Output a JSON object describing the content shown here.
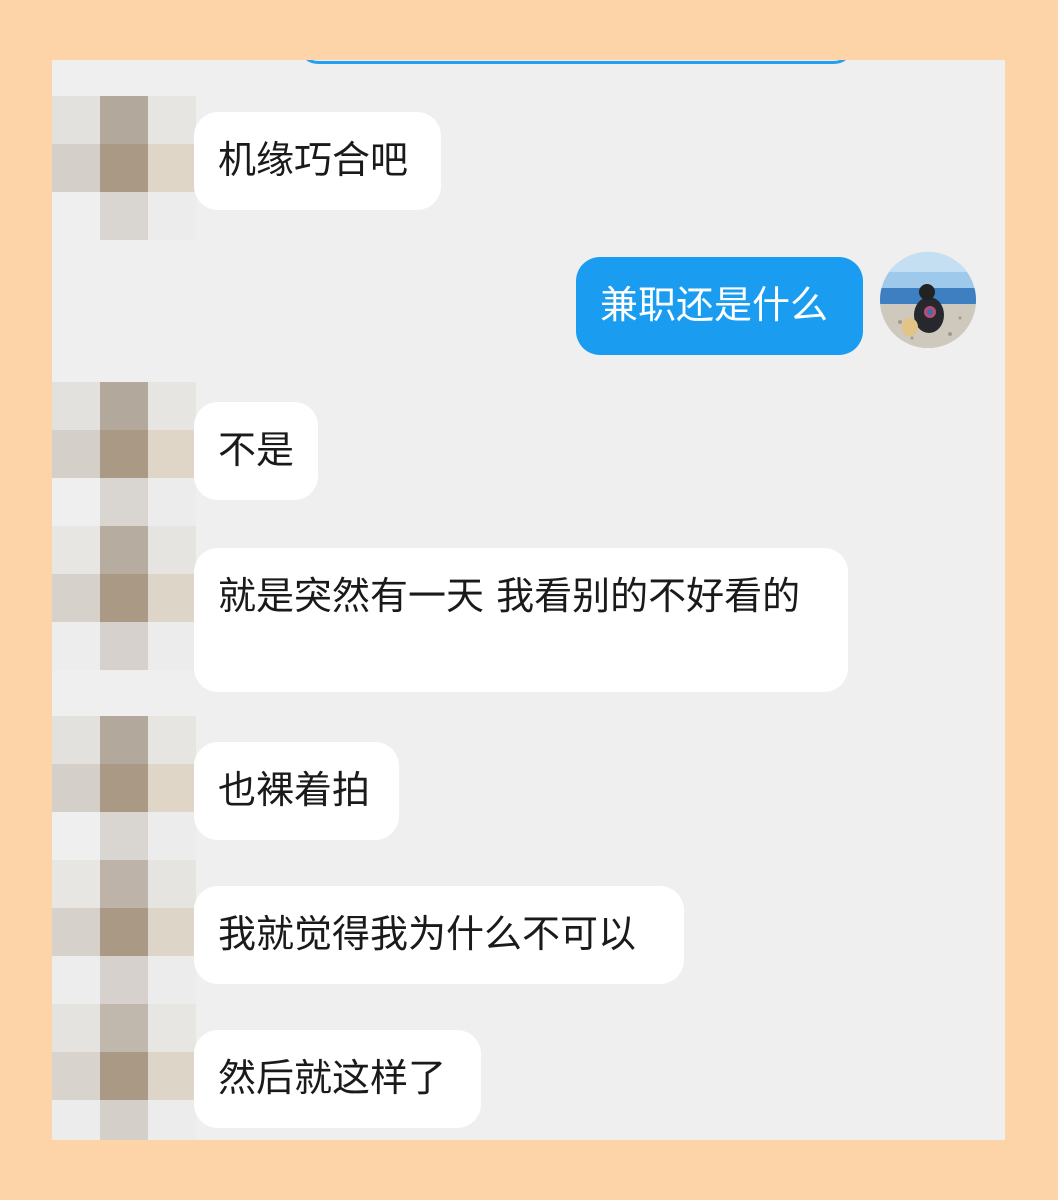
{
  "chat": {
    "messages": [
      {
        "side": "incoming",
        "text": "机缘巧合吧"
      },
      {
        "side": "outgoing",
        "text": "兼职还是什么"
      },
      {
        "side": "incoming",
        "text": "不是"
      },
      {
        "side": "incoming",
        "text": "就是突然有一天 我看别的不好看的"
      },
      {
        "side": "incoming",
        "text": "也裸着拍"
      },
      {
        "side": "incoming",
        "text": "我就觉得我为什么不可以"
      },
      {
        "side": "incoming",
        "text": "然后就这样了"
      }
    ]
  },
  "colors": {
    "page_background": "#fdd3a8",
    "chat_background": "#efefef",
    "incoming_bubble": "#ffffff",
    "outgoing_bubble": "#1a9df0"
  },
  "icons": {
    "contact_avatar": "pixelated-avatar-icon",
    "self_avatar": "beach-photo-avatar-icon"
  }
}
